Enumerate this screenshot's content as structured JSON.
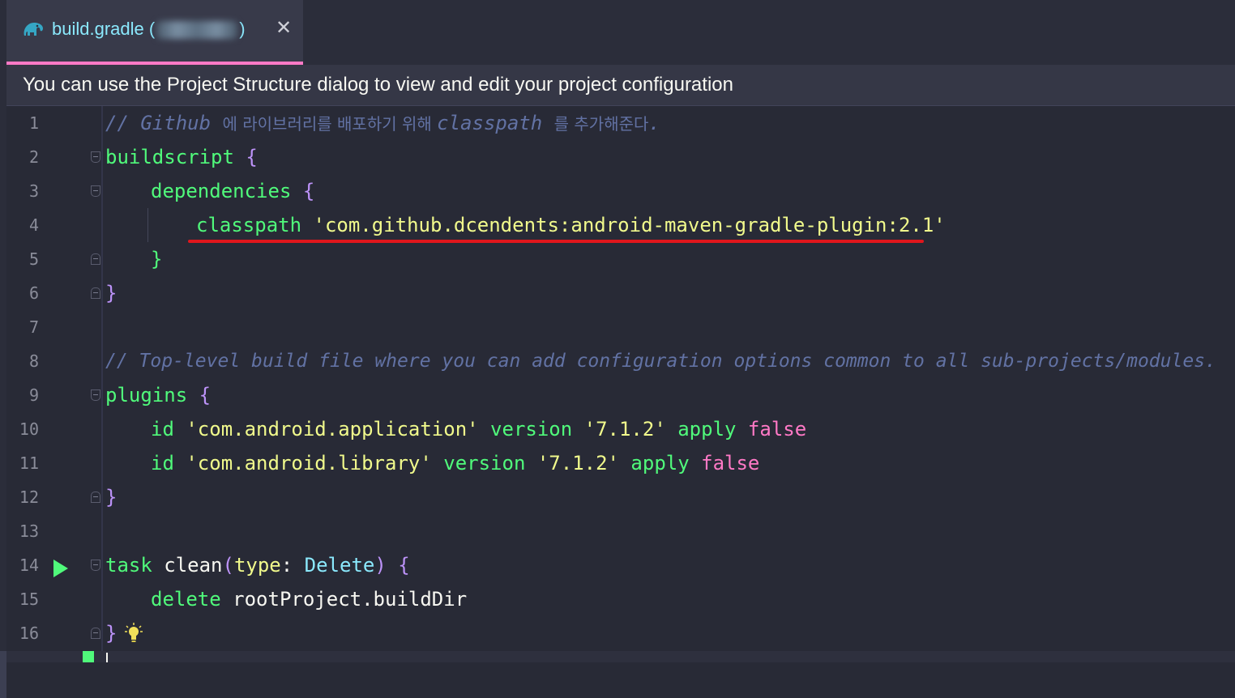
{
  "tab": {
    "title": "build.gradle (",
    "title_end": ")",
    "close": "✕",
    "icon": "gradle-elephant-icon"
  },
  "banner": {
    "text": "You can use the Project Structure dialog to view and edit your project configuration"
  },
  "colors": {
    "background": "#282a36",
    "comment": "#6272a4",
    "keyword": "#50fa7b",
    "string": "#f1fa8c",
    "brace": "#bd93f9",
    "boolean": "#ff79c6",
    "type": "#8be9fd",
    "highlight_underline": "#e0161c"
  },
  "lines": [
    {
      "n": "1"
    },
    {
      "n": "2"
    },
    {
      "n": "3"
    },
    {
      "n": "4"
    },
    {
      "n": "5"
    },
    {
      "n": "6"
    },
    {
      "n": "7"
    },
    {
      "n": "8"
    },
    {
      "n": "9"
    },
    {
      "n": "10"
    },
    {
      "n": "11"
    },
    {
      "n": "12"
    },
    {
      "n": "13"
    },
    {
      "n": "14"
    },
    {
      "n": "15"
    },
    {
      "n": "16"
    }
  ],
  "code": {
    "l1_a": "// Github ",
    "l1_b": "에 라이브러리를 배포하기 위해 ",
    "l1_c": "classpath ",
    "l1_d": "를 추가해준다",
    "l1_e": ".",
    "l2_kw": "buildscript",
    "l2_br": " {",
    "l3_kw": "dependencies",
    "l3_br": " {",
    "l4_kw": "classpath",
    "l4_str": " 'com.github.dcendents:android-maven-gradle-plugin:2.1'",
    "l5_br": "}",
    "l6_br": "}",
    "l8_cm": "// Top-level build file where you can add configuration options common to all sub-projects/modules.",
    "l9_kw": "plugins",
    "l9_br": " {",
    "l10_id": "id",
    "l10_str": " 'com.android.application'",
    "l10_ver": " version",
    "l10_vstr": " '7.1.2'",
    "l10_apply": " apply",
    "l10_false": " false",
    "l11_id": "id",
    "l11_str": " 'com.android.library'",
    "l11_ver": " version",
    "l11_vstr": " '7.1.2'",
    "l11_apply": " apply",
    "l11_false": " false",
    "l12_br": "}",
    "l14_task": "task",
    "l14_clean": " clean",
    "l14_open": "(",
    "l14_type": "type",
    "l14_colon": ": ",
    "l14_delete": "Delete",
    "l14_close": ")",
    "l14_br": " {",
    "l15_del": "delete",
    "l15_root": " rootProject.buildDir",
    "l16_br": "}"
  }
}
